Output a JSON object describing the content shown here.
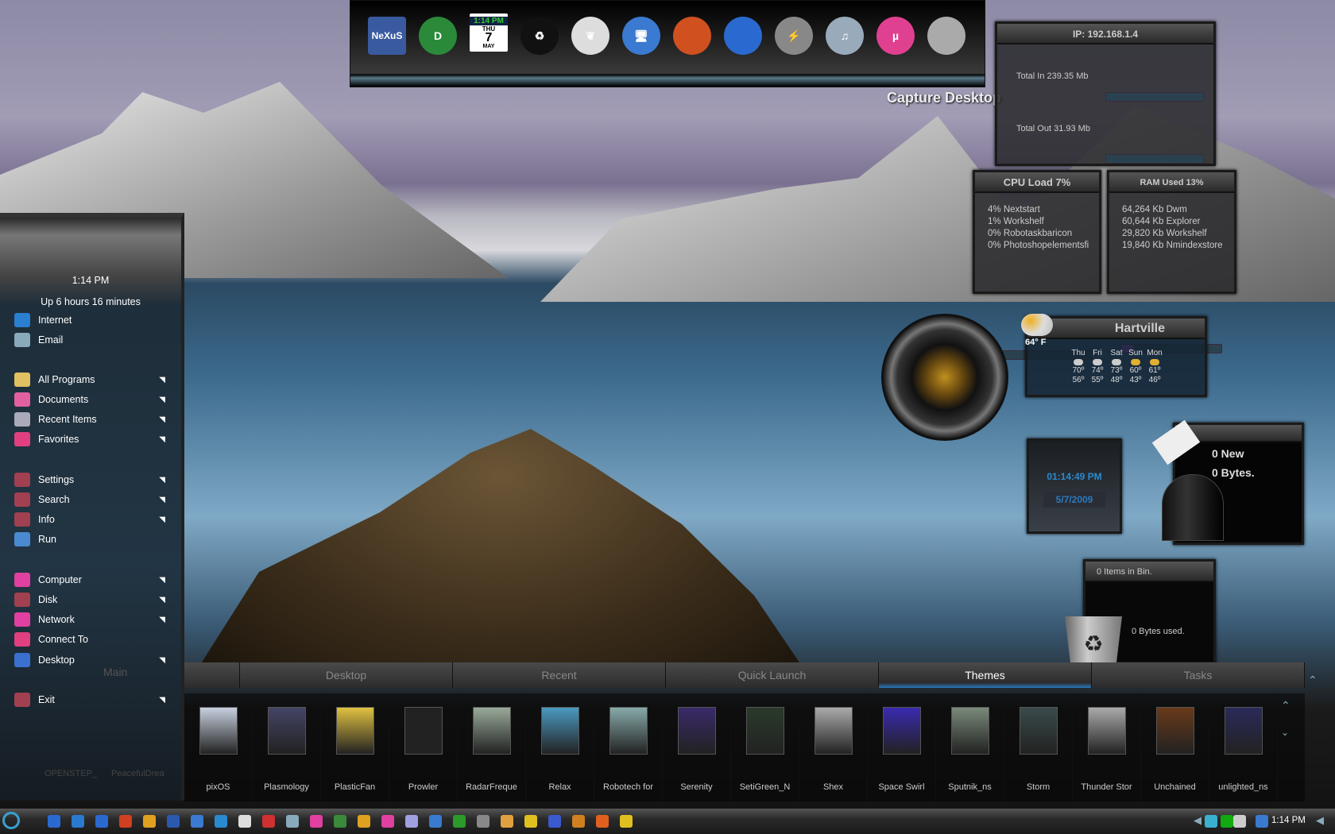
{
  "dock": {
    "icons": [
      {
        "name": "nexus-icon",
        "label": "NeXuS",
        "color": "#3a5aa0"
      },
      {
        "name": "dreamweaver-icon",
        "label": "D",
        "color": "#2a8a3a"
      },
      {
        "name": "calendar-clock-icon",
        "label": "",
        "color": "#fff"
      },
      {
        "name": "recycle-icon",
        "label": "♻",
        "color": "#111"
      },
      {
        "name": "photoshop-elements-icon",
        "label": "❦",
        "color": "#ddd"
      },
      {
        "name": "computer-icon",
        "label": "🖥",
        "color": "#3a7ad0"
      },
      {
        "name": "firefox-icon",
        "label": "",
        "color": "#d05020"
      },
      {
        "name": "globe-icon",
        "label": "",
        "color": "#2a6ad0"
      },
      {
        "name": "winamp-icon",
        "label": "⚡",
        "color": "#888"
      },
      {
        "name": "itunes-icon",
        "label": "♫",
        "color": "#9ab"
      },
      {
        "name": "utorrent-icon",
        "label": "µ",
        "color": "#e04090"
      },
      {
        "name": "drive-icon",
        "label": "",
        "color": "#aaa"
      }
    ],
    "clock_time": "1:14",
    "clock_ampm": "PM",
    "cal_day": "THU",
    "cal_date": "7",
    "cal_month": "MAY"
  },
  "capture_label": "Capture Desktop",
  "network": {
    "ip": "IP: 192.168.1.4",
    "total_in": "Total In 239.35 Mb",
    "total_out": "Total Out 31.93 Mb"
  },
  "cpu": {
    "title": "CPU Load 7%",
    "load_fraction": 0.07,
    "processes": [
      "4% Nextstart",
      "1% Workshelf",
      "0% Robotaskbaricon",
      "0% Photoshopelementsfi"
    ]
  },
  "ram": {
    "title": "RAM Used 13%",
    "used_fraction": 0.13,
    "processes": [
      "64,264 Kb Dwm",
      "60,644 Kb Explorer",
      "29,820 Kb Workshelf",
      "19,840 Kb Nmindexstore"
    ]
  },
  "weather": {
    "city": "Hartville",
    "current": "64° F",
    "days": [
      {
        "d": "Thu",
        "hi": "70º",
        "lo": "56º"
      },
      {
        "d": "Fri",
        "hi": "74º",
        "lo": "55º"
      },
      {
        "d": "Sat",
        "hi": "73º",
        "lo": "48º"
      },
      {
        "d": "Sun",
        "hi": "60º",
        "lo": "43º"
      },
      {
        "d": "Mon",
        "hi": "61º",
        "lo": "46º"
      }
    ]
  },
  "clock": {
    "time": "01:14:49 PM",
    "date": "5/7/2009"
  },
  "mail": {
    "new": "0 New",
    "bytes": "0 Bytes."
  },
  "bin": {
    "items": "0 Items in Bin.",
    "used": "0 Bytes used."
  },
  "start_menu": {
    "time": "1:14 PM",
    "uptime": "Up 6 hours 16 minutes",
    "items": [
      {
        "label": "Internet",
        "color": "#2a80d0",
        "sub": false
      },
      {
        "label": "Email",
        "color": "#8ab",
        "sub": false
      },
      {
        "label": "All Programs",
        "color": "#e0c060",
        "sub": true
      },
      {
        "label": "Documents",
        "color": "#e060a0",
        "sub": true
      },
      {
        "label": "Recent Items",
        "color": "#aab",
        "sub": true
      },
      {
        "label": "Favorites",
        "color": "#e04080",
        "sub": true
      },
      {
        "label": "Settings",
        "color": "#a04050",
        "sub": true
      },
      {
        "label": "Search",
        "color": "#a04050",
        "sub": true
      },
      {
        "label": "Info",
        "color": "#a04050",
        "sub": true
      },
      {
        "label": "Run",
        "color": "#4a8ad0",
        "sub": false
      },
      {
        "label": "Computer",
        "color": "#e040a0",
        "sub": true
      },
      {
        "label": "Disk",
        "color": "#a04050",
        "sub": true
      },
      {
        "label": "Network",
        "color": "#e040a0",
        "sub": true
      },
      {
        "label": "Connect To",
        "color": "#e04080",
        "sub": false
      },
      {
        "label": "Desktop",
        "color": "#3a70d0",
        "sub": true
      },
      {
        "label": "Exit",
        "color": "#a04050",
        "sub": true
      }
    ]
  },
  "shelf": {
    "main_tab": "Main",
    "tabs": [
      "Desktop",
      "Recent",
      "Quick Launch",
      "Themes",
      "Tasks"
    ],
    "active_tab": "Themes",
    "hidden_items": [
      "OPENSTEP_",
      "PeacefulDrea"
    ],
    "themes": [
      {
        "n": "pixOS",
        "c": "#c8d0e0"
      },
      {
        "n": "Plasmology",
        "c": "#446"
      },
      {
        "n": "PlasticFan",
        "c": "#e0c040"
      },
      {
        "n": "Prowler",
        "c": "#222"
      },
      {
        "n": "RadarFreque",
        "c": "#9a9"
      },
      {
        "n": "Relax",
        "c": "#4a9ac0"
      },
      {
        "n": "Robotech for",
        "c": "#8aa"
      },
      {
        "n": "Serenity",
        "c": "#3a2a6a"
      },
      {
        "n": "SetiGreen_N",
        "c": "#2a3a2a"
      },
      {
        "n": "Shex",
        "c": "#aaa"
      },
      {
        "n": "Space Swirl",
        "c": "#3a2ab0"
      },
      {
        "n": "Sputnik_ns",
        "c": "#7a8a7a"
      },
      {
        "n": "Storm",
        "c": "#3a4a4a"
      },
      {
        "n": "Thunder Stor",
        "c": "#aaa"
      },
      {
        "n": "Unchained",
        "c": "#6a3a1a"
      },
      {
        "n": "unlighted_ns",
        "c": "#2a2a5a"
      }
    ]
  },
  "taskbar": {
    "time": "1:14 PM",
    "icons": [
      "#2a6ad0",
      "#2a7ad0",
      "#2a6ad0",
      "#d04020",
      "#e0a020",
      "#2a5ab0",
      "#3a7ad0",
      "#2a8ad0",
      "#ddd",
      "#d03030",
      "#8ab",
      "#e040a0",
      "#3a8a3a",
      "#e0a020",
      "#e040a0",
      "#a0a0e0",
      "#3a7ad0",
      "#2a9a2a",
      "#888",
      "#e0a040",
      "#e0c020",
      "#3a5ad0",
      "#d08020",
      "#e06020",
      "#e0c020"
    ]
  }
}
